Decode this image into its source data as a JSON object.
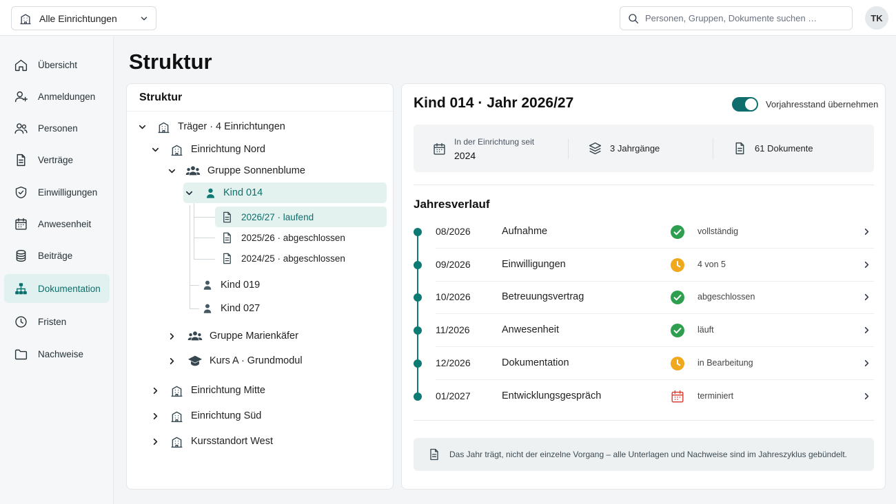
{
  "topbar": {
    "facility_label": "Alle Einrichtungen",
    "search_placeholder": "Personen, Gruppen, Dokumente suchen …",
    "avatar_initials": "TK"
  },
  "sidebar": {
    "items": [
      {
        "label": "Übersicht",
        "icon": "home-icon"
      },
      {
        "label": "Anmeldungen",
        "icon": "user-add-icon"
      },
      {
        "label": "Personen",
        "icon": "people-icon"
      },
      {
        "label": "Verträge",
        "icon": "document-icon"
      },
      {
        "label": "Einwilligungen",
        "icon": "shield-icon"
      },
      {
        "label": "Anwesenheit",
        "icon": "calendar-icon"
      },
      {
        "label": "Beiträge",
        "icon": "coins-icon"
      },
      {
        "label": "Dokumentation",
        "icon": "hierarchy-icon",
        "active": true
      },
      {
        "label": "Fristen",
        "icon": "clock-icon"
      },
      {
        "label": "Nachweise",
        "icon": "folder-icon"
      }
    ]
  },
  "page": {
    "title": "Struktur"
  },
  "tree": {
    "title": "Struktur",
    "nodes": [
      {
        "label": "Träger · 4 Einrichtungen",
        "icon": "building-icon",
        "expanded": true
      },
      {
        "label": "Einrichtung Nord",
        "icon": "building-icon",
        "expanded": true
      },
      {
        "label": "Gruppe Sonnenblume",
        "icon": "group-icon",
        "expanded": true
      },
      {
        "label": "Kind 014",
        "icon": "person-icon",
        "expanded": true,
        "selected": true
      },
      {
        "label": "2026/27 · laufend",
        "icon": "document-icon",
        "selected": true
      },
      {
        "label": "2025/26 · abgeschlossen",
        "icon": "document-icon"
      },
      {
        "label": "2024/25 · abgeschlossen",
        "icon": "document-icon"
      },
      {
        "label": "Kind 019",
        "icon": "person-icon"
      },
      {
        "label": "Kind 027",
        "icon": "person-icon"
      },
      {
        "label": "Gruppe Marienkäfer",
        "icon": "group-icon",
        "expanded": false
      },
      {
        "label": "Kurs A · Grundmodul",
        "icon": "graduation-cap-icon",
        "expanded": false
      },
      {
        "label": "Einrichtung Mitte",
        "icon": "building-icon",
        "expanded": false
      },
      {
        "label": "Einrichtung Süd",
        "icon": "building-icon",
        "expanded": false
      },
      {
        "label": "Kursstandort West",
        "icon": "building-icon",
        "expanded": false
      }
    ]
  },
  "detail": {
    "title": "Kind 014 · Jahr 2026/27",
    "toggle_label": "Vorjahresstand übernehmen",
    "toggle_on": true,
    "info": {
      "since_label": "In der Einrichtung seit",
      "since_value": "2024",
      "years": "3 Jahrgänge",
      "documents": "61 Dokumente"
    },
    "section_title": "Jahresverlauf",
    "timeline": [
      {
        "date": "08/2026",
        "name": "Aufnahme",
        "status": "vollständig",
        "status_icon": "check-circle-icon"
      },
      {
        "date": "09/2026",
        "name": "Einwilligungen",
        "status": "4 von 5",
        "status_icon": "clock-icon"
      },
      {
        "date": "10/2026",
        "name": "Betreuungsvertrag",
        "status": "abgeschlossen",
        "status_icon": "check-circle-icon"
      },
      {
        "date": "11/2026",
        "name": "Anwesenheit",
        "status": "läuft",
        "status_icon": "check-circle-icon"
      },
      {
        "date": "12/2026",
        "name": "Dokumentation",
        "status": "in Bearbeitung",
        "status_icon": "clock-icon"
      },
      {
        "date": "01/2027",
        "name": "Entwicklungsgespräch",
        "status": "terminiert",
        "status_icon": "calendar-icon"
      }
    ],
    "note": "Das Jahr trägt, nicht der einzelne Vorgang – alle Unterlagen und Nachweise sind im Jahreszyklus gebündelt."
  },
  "colors": {
    "accent": "#0d7a74",
    "active_bg": "#e1f1ef",
    "success": "#2e9e4f",
    "warning": "#f0a81c",
    "danger": "#d9433a"
  }
}
